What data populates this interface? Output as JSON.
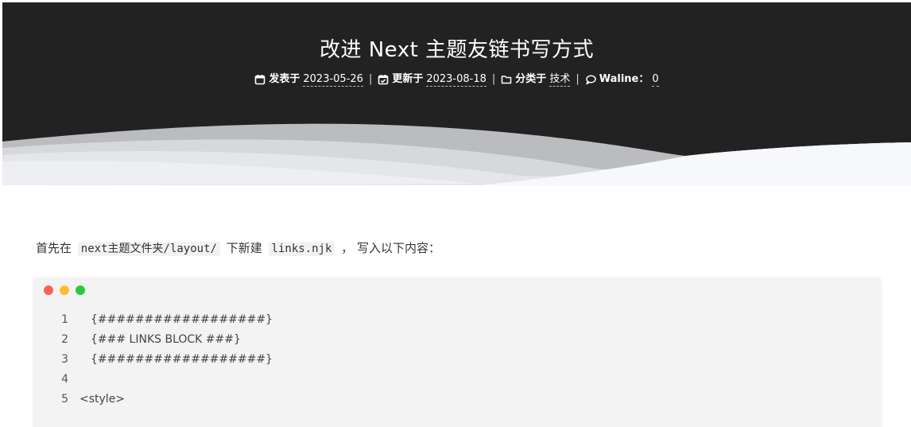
{
  "post": {
    "title": "改进 Next 主题友链书写方式",
    "meta": {
      "published_label": "发表于",
      "published_date": "2023-05-26",
      "updated_label": "更新于",
      "updated_date": "2023-08-18",
      "category_label": "分类于",
      "category": "技术",
      "comments_label": "Waline：",
      "comments_count": "0",
      "separator": "|"
    }
  },
  "content": {
    "intro_prefix": "首先在",
    "path_code": "next主题文件夹/layout/",
    "intro_middle": "下新建",
    "file_code": "links.njk",
    "intro_suffix": "， 写入以下内容："
  },
  "code": {
    "lines": [
      {
        "num": "1",
        "text": "{##################}"
      },
      {
        "num": "2",
        "text": "{### LINKS BLOCK ###}"
      },
      {
        "num": "3",
        "text": "{##################}"
      },
      {
        "num": "4",
        "text": ""
      },
      {
        "num": "5",
        "text": "<style>"
      }
    ]
  },
  "colors": {
    "header_bg": "#222222",
    "dot_red": "#ff5f56",
    "dot_yellow": "#ffbd2e",
    "dot_green": "#27c93f",
    "code_bg": "#f3f3f3"
  },
  "icons": [
    "calendar-icon",
    "calendar-check-icon",
    "folder-icon",
    "comment-icon"
  ]
}
